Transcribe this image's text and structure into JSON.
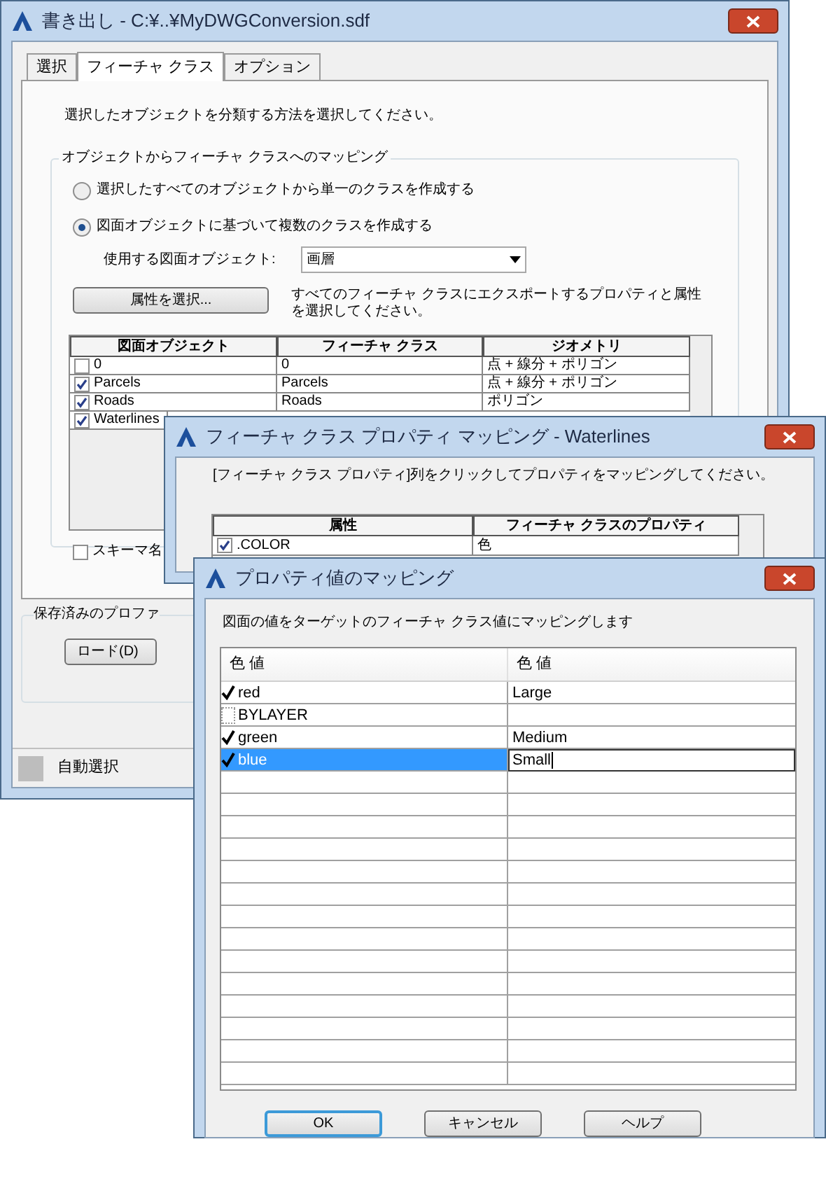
{
  "main_window": {
    "title": "書き出し - C:¥..¥MyDWGConversion.sdf",
    "tabs": [
      {
        "label": "選択",
        "selected": false
      },
      {
        "label": "フィーチャ クラス",
        "selected": true
      },
      {
        "label": "オプション",
        "selected": false
      }
    ],
    "instruction": "選択したオブジェクトを分類する方法を選択してください。",
    "mapping_group": {
      "title": "オブジェクトからフィーチャ クラスへのマッピング",
      "options": [
        {
          "label": "選択したすべてのオブジェクトから単一のクラスを作成する",
          "selected": false
        },
        {
          "label": "図面オブジェクトに基づいて複数のクラスを作成する",
          "selected": true
        }
      ],
      "object_label": "使用する図面オブジェクト:",
      "object_value": "画層",
      "attributes_button": "属性を選択...",
      "attributes_hint": "すべてのフィーチャ クラスにエクスポートするプロパティと属性を選択してください。",
      "table": {
        "columns": [
          "図面オブジェクト",
          "フィーチャ クラス",
          "ジオメトリ"
        ],
        "rows": [
          {
            "checked": false,
            "cells": [
              "0",
              "0",
              "点 + 線分 + ポリゴン"
            ]
          },
          {
            "checked": true,
            "cells": [
              "Parcels",
              "Parcels",
              "点 + 線分 + ポリゴン"
            ]
          },
          {
            "checked": true,
            "cells": [
              "Roads",
              "Roads",
              "ポリゴン"
            ]
          },
          {
            "checked": true,
            "cells": [
              "Waterlines"
            ]
          }
        ]
      },
      "schema_checkbox": {
        "label": "スキーマ名",
        "checked": false
      }
    },
    "profile_group": {
      "title": "保存済みのプロファ",
      "load_button": "ロード(D)"
    },
    "status_bar": "自動選択"
  },
  "property_window": {
    "title": "フィーチャ クラス プロパティ マッピング - Waterlines",
    "instruction": "[フィーチャ クラス プロパティ]列をクリックしてプロパティをマッピングしてください。",
    "table": {
      "columns": [
        "属性",
        "フィーチャ クラスのプロパティ"
      ],
      "rows": [
        {
          "checked": true,
          "cells": [
            ".COLOR",
            "色"
          ]
        }
      ]
    }
  },
  "value_window": {
    "title": "プロパティ値のマッピング",
    "instruction": "図面の値をターゲットのフィーチャ クラス値にマッピングします",
    "table": {
      "columns": [
        "色 値",
        "色 値"
      ],
      "rows": [
        {
          "checked": true,
          "selected": false,
          "source": "red",
          "target": "Large"
        },
        {
          "checked": false,
          "selected": false,
          "source": "BYLAYER"
        },
        {
          "checked": true,
          "selected": false,
          "source": "green",
          "target": "Medium"
        },
        {
          "checked": true,
          "selected": true,
          "source": "blue",
          "target": "Small"
        }
      ]
    },
    "buttons": [
      {
        "label": "OK",
        "default": true
      },
      {
        "label": "キャンセル",
        "default": false
      },
      {
        "label": "ヘルプ",
        "default": false
      }
    ]
  }
}
